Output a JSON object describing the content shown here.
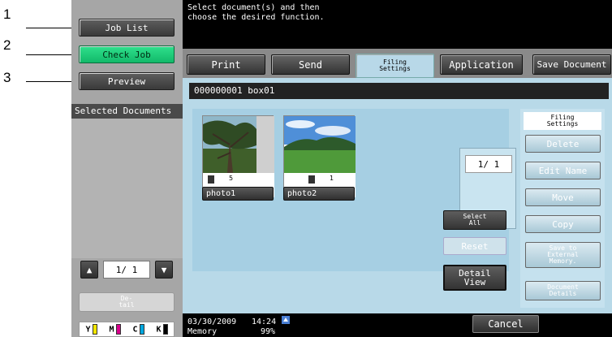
{
  "callouts": [
    {
      "number": "1"
    },
    {
      "number": "2"
    },
    {
      "number": "3"
    }
  ],
  "left": {
    "job_list": "Job List",
    "check_job": "Check Job",
    "preview": "Preview",
    "selected_documents": "Selected Documents",
    "page": "1/  1",
    "detail": "De-\ntail",
    "toner": [
      {
        "label": "Y",
        "color": "#f2e600"
      },
      {
        "label": "M",
        "color": "#d8008c"
      },
      {
        "label": "C",
        "color": "#00a8e0"
      },
      {
        "label": "K",
        "color": "#000000"
      }
    ]
  },
  "message": "Select document(s) and then\nchoose the desired function.",
  "tabs": {
    "print": "Print",
    "send": "Send",
    "filing": "Filing\nSettings",
    "application": "Application",
    "save": "Save Document"
  },
  "box": "000000001   box01",
  "documents": [
    {
      "name": "photo1",
      "pages": "5"
    },
    {
      "name": "photo2",
      "pages": "1"
    }
  ],
  "main": {
    "page": "1/  1",
    "select_all": "Select\nAll",
    "reset": "Reset",
    "detail_view": "Detail\nView"
  },
  "filing": {
    "title": "Filing\nSettings",
    "delete": "Delete",
    "edit_name": "Edit Name",
    "move": "Move",
    "copy": "Copy",
    "save_external": "Save to\nExternal\nMemory.",
    "document_details": "Document\nDetails"
  },
  "status": {
    "date": "03/30/2009",
    "time": "14:24",
    "memory_label": "Memory",
    "memory_value": "99%"
  },
  "cancel": "Cancel"
}
